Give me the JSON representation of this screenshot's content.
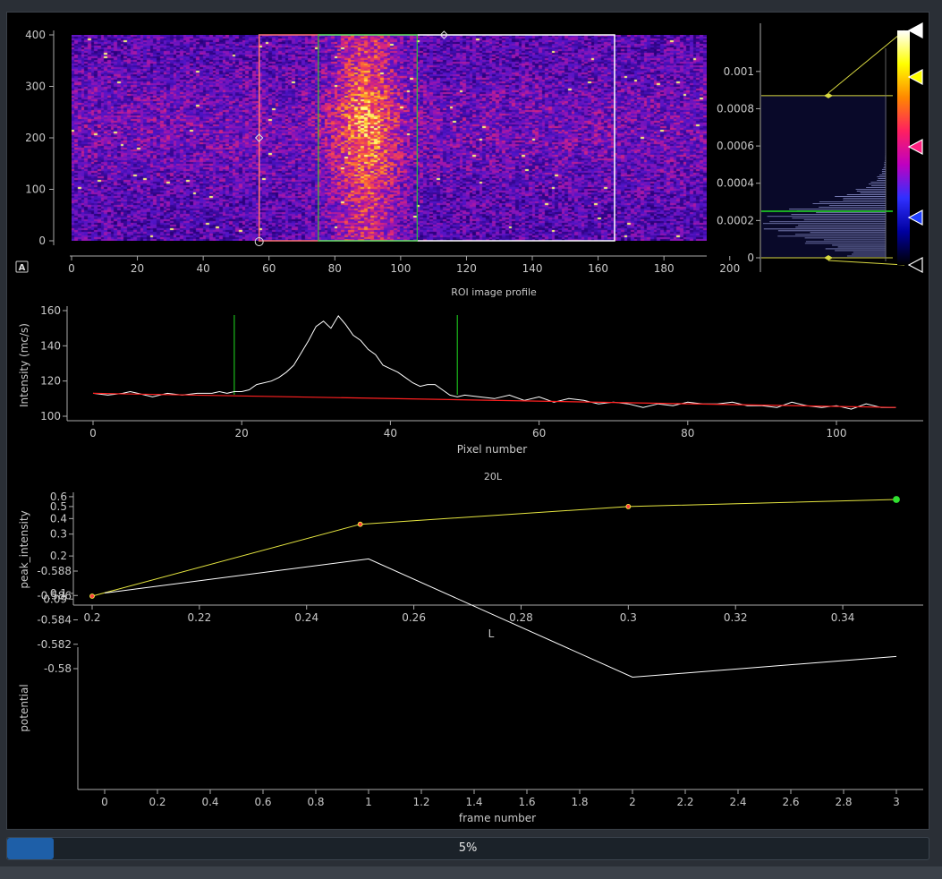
{
  "image_view": {
    "x_ticks": [
      "0",
      "20",
      "40",
      "60",
      "80",
      "100",
      "120",
      "140",
      "160",
      "180",
      "200"
    ],
    "y_ticks": [
      "0",
      "100",
      "200",
      "300",
      "400"
    ],
    "auto_button": "A",
    "roi_pixels": {
      "x0": 57,
      "x1": 165
    },
    "window_green": {
      "x0": 75,
      "x1": 105
    }
  },
  "histogram": {
    "y_ticks": [
      "0",
      "0.0002",
      "0.0004",
      "0.0006",
      "0.0008",
      "0.001"
    ],
    "levels": {
      "min": 0,
      "max": 0.00087
    },
    "green_level": 0.00025,
    "gradient_stops": [
      "#ffffff",
      "#ffff00",
      "#ff8800",
      "#ff2060",
      "#c000c0",
      "#3030ff",
      "#0000a0",
      "#000000"
    ],
    "handle_colors": [
      "#ffffff",
      "#ffff00",
      "#ff2080",
      "#2040ff",
      "#000000"
    ]
  },
  "roi_profile": {
    "title": "ROI image profile",
    "xlabel": "Pixel number",
    "ylabel": "Intensity (mc/s)",
    "x_ticks": [
      "0",
      "20",
      "40",
      "60",
      "80",
      "100"
    ],
    "y_ticks": [
      "100",
      "120",
      "140",
      "160"
    ]
  },
  "peak_plot": {
    "title": "20L",
    "xlabel": "L",
    "ylabel": "peak_intensity",
    "x_ticks": [
      "0.2",
      "0.22",
      "0.24",
      "0.26",
      "0.28",
      "0.3",
      "0.32",
      "0.34"
    ],
    "y_ticks": [
      "0.09",
      "0.1",
      "0.2",
      "0.3",
      "0.4",
      "0.5",
      "0.6"
    ]
  },
  "potential_plot": {
    "xlabel": "frame number",
    "ylabel": "potential",
    "x_ticks": [
      "0",
      "0.2",
      "0.4",
      "0.6",
      "0.8",
      "1",
      "1.2",
      "1.4",
      "1.6",
      "1.8",
      "2",
      "2.2",
      "2.4",
      "2.6",
      "2.8",
      "3"
    ],
    "y_ticks": [
      "-0.588",
      "-0.586",
      "-0.584",
      "-0.582",
      "-0.58"
    ]
  },
  "progress": {
    "value": 0.05,
    "label": "5%"
  },
  "chart_data": [
    {
      "type": "heatmap",
      "xlim": [
        0,
        193
      ],
      "ylim": [
        0,
        400
      ],
      "colormap": "fire",
      "peak_center_x": 89
    },
    {
      "type": "line",
      "title": "ROI image profile",
      "xlabel": "Pixel number",
      "ylabel": "Intensity (mc/s)",
      "xlim": [
        -4,
        112
      ],
      "ylim": [
        98,
        162
      ],
      "series": [
        {
          "color": "#ffffff",
          "x": [
            0,
            2,
            4,
            5,
            6,
            8,
            10,
            12,
            14,
            16,
            17,
            18,
            19,
            20,
            21,
            22,
            24,
            25,
            26,
            27,
            28,
            29,
            30,
            31,
            32,
            33,
            34,
            35,
            36,
            37,
            38,
            39,
            40,
            41,
            42,
            43,
            44,
            45,
            46,
            47,
            48,
            49,
            50,
            52,
            54,
            56,
            58,
            60,
            62,
            64,
            66,
            68,
            70,
            72,
            74,
            76,
            78,
            80,
            82,
            84,
            86,
            88,
            90,
            92,
            94,
            96,
            98,
            100,
            102,
            104,
            106,
            108
          ],
          "y": [
            113,
            112,
            113,
            114,
            113,
            111,
            113,
            112,
            113,
            113,
            114,
            113,
            114,
            114,
            115,
            118,
            120,
            122,
            125,
            129,
            136,
            143,
            151,
            154,
            150,
            157,
            152,
            146,
            143,
            138,
            135,
            129,
            127,
            125,
            122,
            119,
            117,
            118,
            118,
            115,
            112,
            111,
            112,
            111,
            110,
            112,
            109,
            111,
            108,
            110,
            109,
            107,
            108,
            107,
            105,
            107,
            106,
            108,
            107,
            107,
            108,
            106,
            106,
            105,
            108,
            106,
            105,
            106,
            104,
            107,
            105,
            105
          ]
        },
        {
          "color": "#ff2020",
          "x": [
            0,
            108
          ],
          "y": [
            113,
            105
          ]
        }
      ],
      "markers": [
        {
          "x": 19,
          "color": "#20e020"
        },
        {
          "x": 49,
          "color": "#20e020"
        }
      ]
    },
    {
      "type": "line",
      "title": "20L",
      "xlabel": "L",
      "ylabel": "peak_intensity",
      "log_y": true,
      "xlim": [
        0.196,
        0.354
      ],
      "ylim": [
        0.088,
        0.64
      ],
      "series": [
        {
          "color": "#ffff40",
          "x": [
            0.2,
            0.25,
            0.3,
            0.35
          ],
          "y": [
            0.095,
            0.36,
            0.5,
            0.57
          ]
        }
      ]
    },
    {
      "type": "line",
      "xlabel": "frame number",
      "ylabel": "potential",
      "xlim": [
        -0.1,
        3.1
      ],
      "ylim": [
        -0.5891,
        -0.5791
      ],
      "series": [
        {
          "color": "#ffffff",
          "x": [
            0,
            1,
            2,
            3
          ],
          "y": [
            -0.5862,
            -0.589,
            -0.5793,
            -0.581
          ]
        }
      ]
    }
  ]
}
